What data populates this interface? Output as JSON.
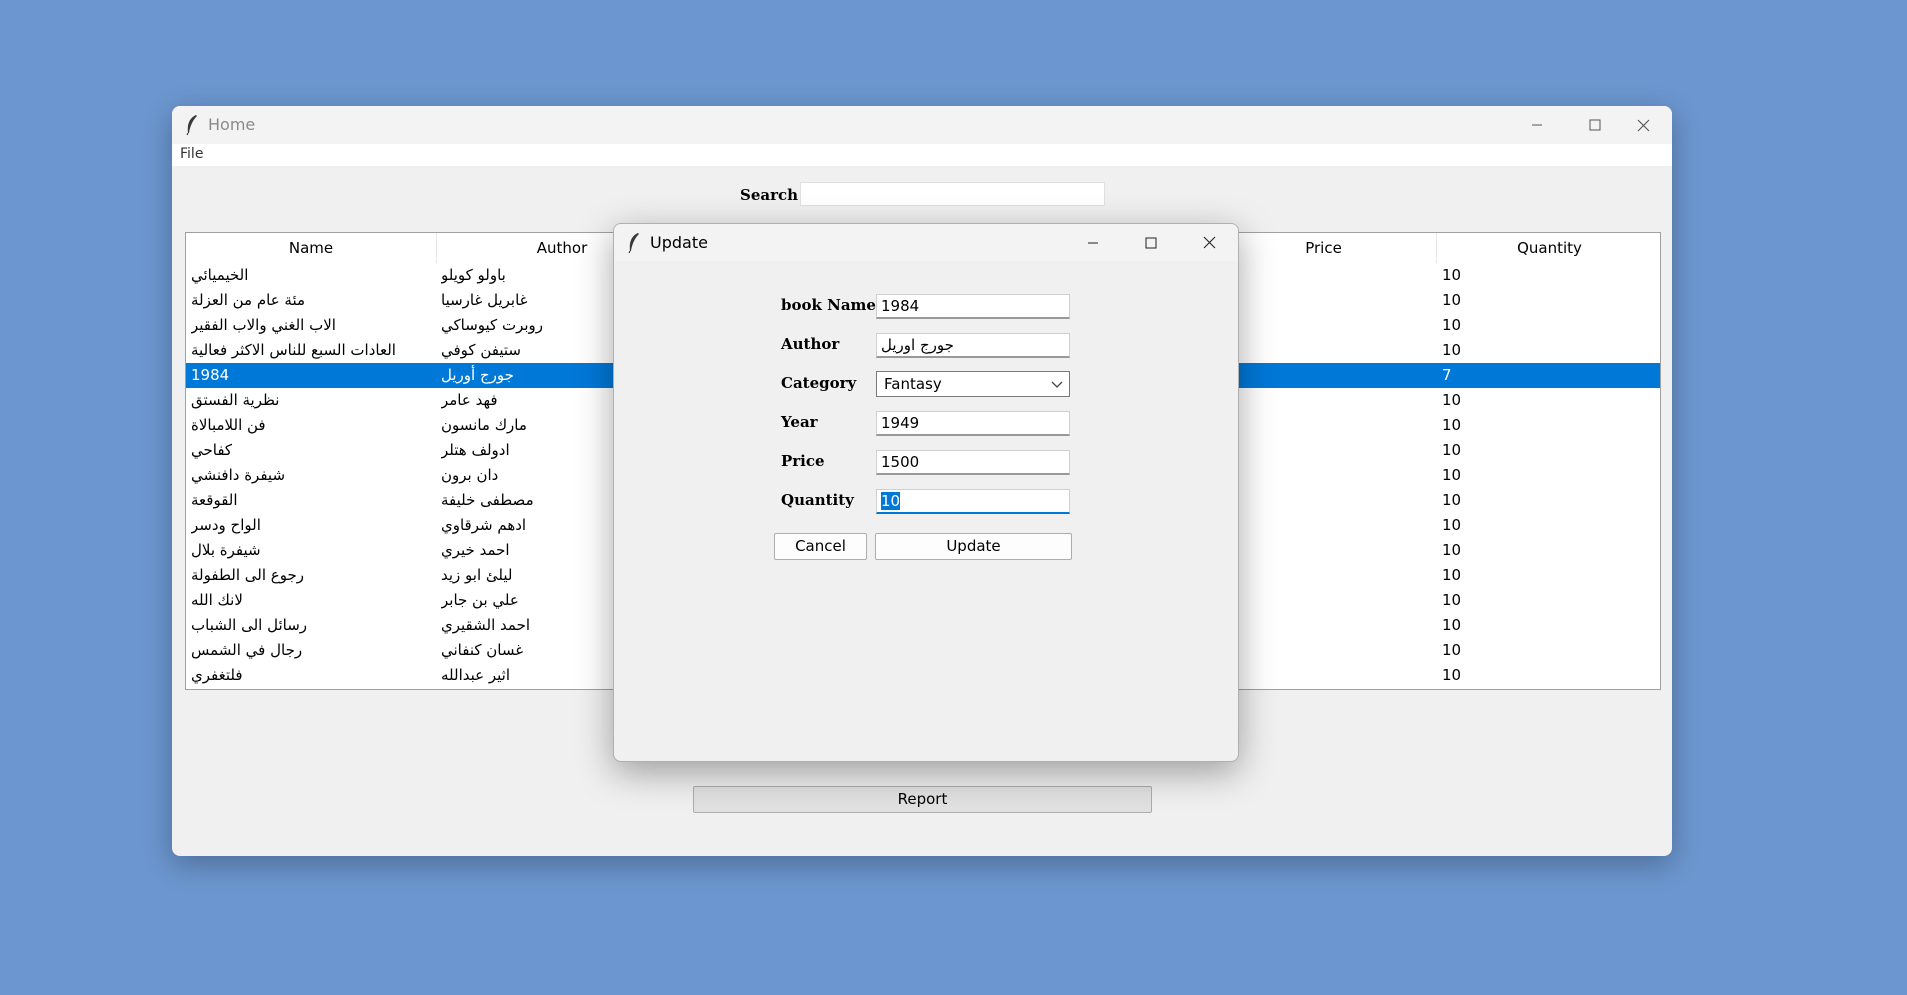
{
  "main_window": {
    "title": "Home",
    "menu": {
      "file": "File"
    },
    "search": {
      "label": "Search",
      "value": ""
    },
    "table": {
      "columns": {
        "name": "Name",
        "author": "Author",
        "price": "Price",
        "quantity": "Quantity"
      },
      "rows": [
        {
          "name": "الخيميائي",
          "author": "باولو كويلو",
          "quantity": "10"
        },
        {
          "name": "مئة عام من العزلة",
          "author": "غابريل غارسيا",
          "quantity": "10"
        },
        {
          "name": "الاب الغني والاب الفقير",
          "author": "روبرت كيوساكي",
          "quantity": "10"
        },
        {
          "name": "العادات السبع للناس الاكثر فعالية",
          "author": "ستيفن كوفي",
          "quantity": "10"
        },
        {
          "name": "1984",
          "author": "جورج أوريل",
          "quantity": "7",
          "selected": true
        },
        {
          "name": "نظرية الفستق",
          "author": "فهد عامر",
          "quantity": "10"
        },
        {
          "name": "فن اللامبالاة",
          "author": "مارك مانسون",
          "quantity": "10"
        },
        {
          "name": "كفاحي",
          "author": "ادولف هتلر",
          "quantity": "10"
        },
        {
          "name": "شيفرة دافنشي",
          "author": "دان برون",
          "quantity": "10"
        },
        {
          "name": "القوقعة",
          "author": "مصطفى خليفة",
          "quantity": "10"
        },
        {
          "name": "الواح ودسر",
          "author": "ادهم شرقاوي",
          "quantity": "10"
        },
        {
          "name": "شيفرة بلال",
          "author": "احمد خيري",
          "quantity": "10"
        },
        {
          "name": "رجوع الى الطفولة",
          "author": "ليلئ ابو زيد",
          "quantity": "10"
        },
        {
          "name": "لانك الله",
          "author": "علي بن جابر",
          "quantity": "10"
        },
        {
          "name": "رسائل الى الشباب",
          "author": "احمد الشقيري",
          "quantity": "10"
        },
        {
          "name": "رجال في الشمس",
          "author": "غسان كنفاني",
          "quantity": "10"
        },
        {
          "name": "فلتغفري",
          "author": "اثير عبدالله",
          "quantity": "10"
        }
      ]
    },
    "report_button": "Report"
  },
  "dialog": {
    "title": "Update",
    "fields": {
      "book_name": {
        "label": "book Name",
        "value": "1984"
      },
      "author": {
        "label": "Author",
        "value": "جورج اوريل"
      },
      "category": {
        "label": "Category",
        "value": "Fantasy"
      },
      "year": {
        "label": "Year",
        "value": "1949"
      },
      "price": {
        "label": "Price",
        "value": "1500"
      },
      "quantity": {
        "label": "Quantity",
        "value": "10"
      }
    },
    "cancel_button": "Cancel",
    "update_button": "Update"
  },
  "icons": {
    "app": "feather-icon",
    "minimize": "minimize-icon",
    "maximize": "maximize-icon",
    "close": "close-icon",
    "dropdown": "chevron-down-icon"
  },
  "colors": {
    "desktop": "#6b96cf",
    "selection": "#0078d7",
    "window": "#f0f0f0"
  }
}
